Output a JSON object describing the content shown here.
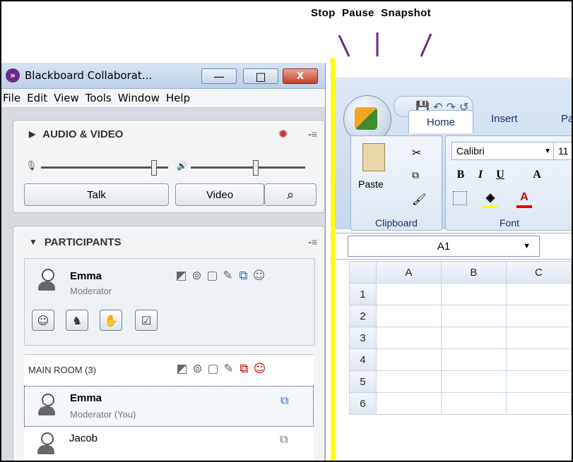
{
  "annotation": {
    "labels": [
      "Stop",
      "Pause",
      "Snapshot"
    ]
  },
  "blackboard": {
    "title": "Blackboard Collaborat...",
    "window_buttons": {
      "minimize": "—",
      "maximize": "□",
      "close": "X"
    },
    "menu": [
      "File",
      "Edit",
      "View",
      "Tools",
      "Window",
      "Help"
    ],
    "audio_video": {
      "title": "AUDIO & VIDEO",
      "talk_label": "Talk",
      "video_label": "Video"
    },
    "participants": {
      "title": "PARTICIPANTS",
      "me": {
        "name": "Emma",
        "role": "Moderator"
      },
      "main_room_label": "MAIN ROOM (3)",
      "list": [
        {
          "name": "Emma",
          "role": "Moderator (You)"
        },
        {
          "name": "Jacob",
          "role": ""
        }
      ]
    }
  },
  "excel": {
    "tabs": [
      "Home",
      "Insert",
      "Pa"
    ],
    "clipboard": {
      "paste_label": "Paste",
      "group_label": "Clipboard"
    },
    "font": {
      "name": "Calibri",
      "size": "11",
      "group_label": "Font"
    },
    "name_box": "A1",
    "columns": [
      "A",
      "B",
      "C"
    ],
    "rows": [
      "1",
      "2",
      "3",
      "4",
      "5",
      "6"
    ]
  },
  "colors": {
    "highlight": "#ffff00",
    "accent_purple": "#6b2a8d"
  }
}
